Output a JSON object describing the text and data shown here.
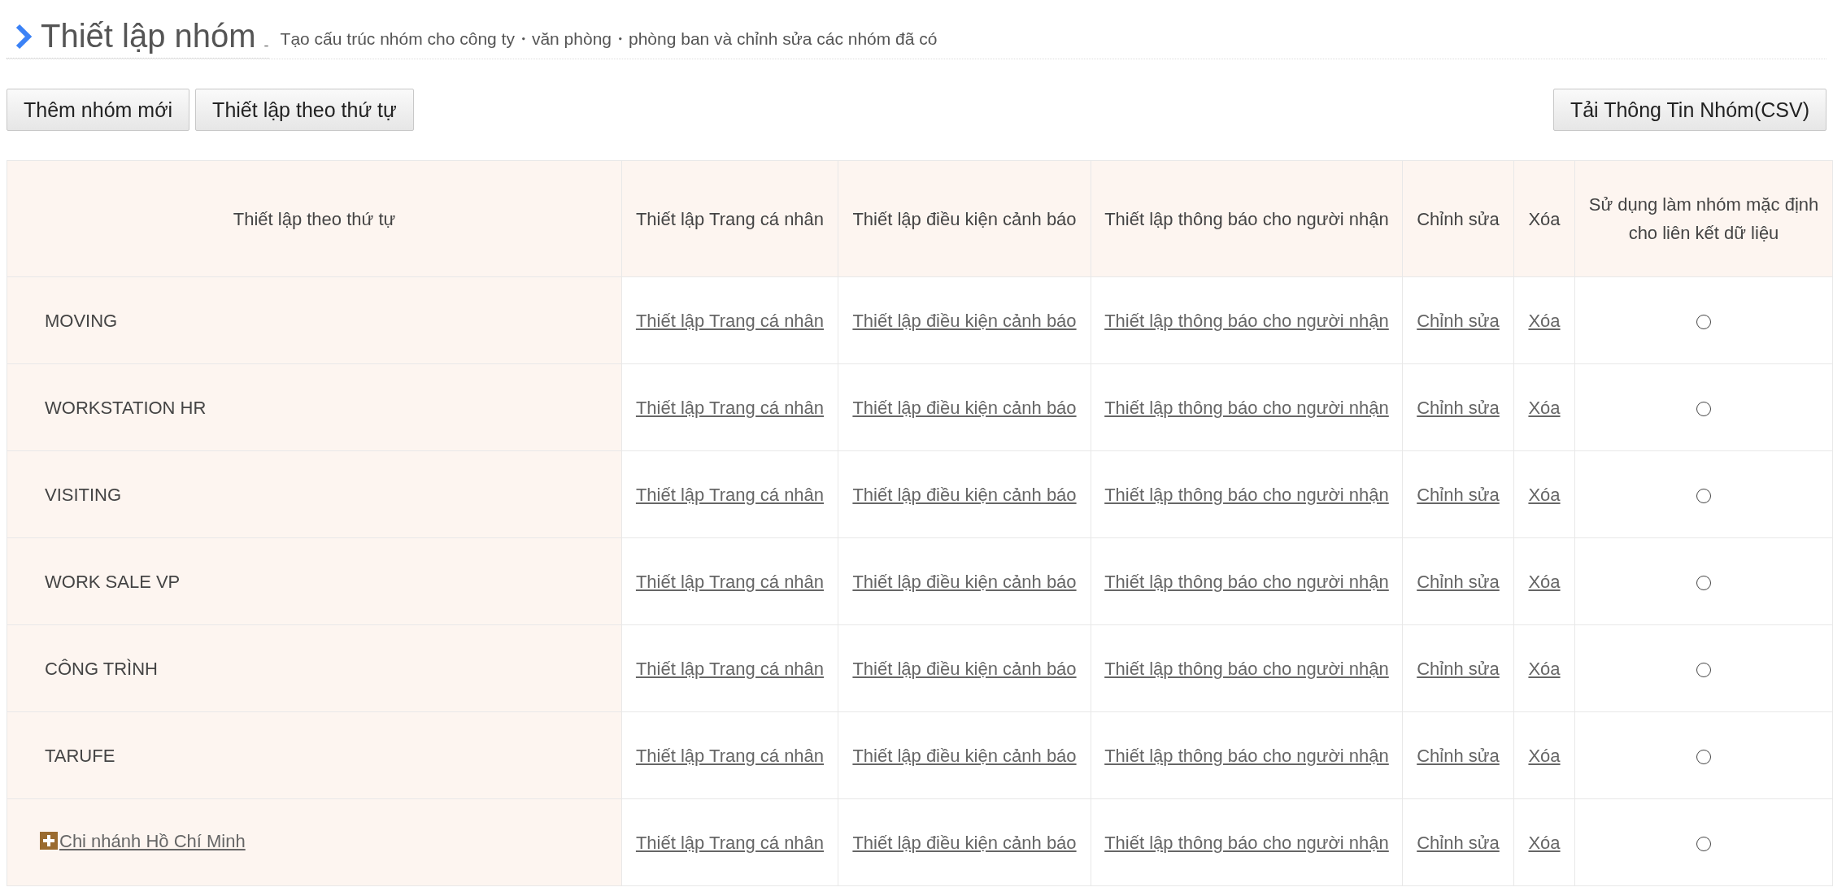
{
  "header": {
    "title": "Thiết lập nhóm",
    "separator": "-",
    "subtitle": "Tạo cấu trúc nhóm cho công ty・văn phòng・phòng ban và chỉnh sửa các nhóm đã có"
  },
  "toolbar": {
    "left_buttons": [
      "Thêm nhóm mới",
      "Thiết lập theo thứ tự"
    ],
    "right_button": "Tải Thông Tin Nhóm(CSV)"
  },
  "table": {
    "columns": [
      {
        "lines": [
          "Thiết lập theo thứ tự"
        ]
      },
      {
        "lines": [
          "Thiết lập Trang cá nhân"
        ]
      },
      {
        "lines": [
          "Thiết lập điều kiện cảnh báo"
        ]
      },
      {
        "lines": [
          "Thiết lập thông báo cho người nhận"
        ]
      },
      {
        "lines": [
          "Chỉnh sửa"
        ]
      },
      {
        "lines": [
          "Xóa"
        ]
      },
      {
        "lines": [
          "Sử dụng làm nhóm mặc định",
          "cho liên kết dữ liệu"
        ]
      }
    ],
    "rows": [
      {
        "kind": "plain",
        "name": "MOVING",
        "links": [
          "Thiết lập Trang cá nhân",
          "Thiết lập điều kiện cảnh báo",
          "Thiết lập thông báo cho người nhận",
          "Chỉnh sửa",
          "Xóa"
        ],
        "selected": false
      },
      {
        "kind": "plain",
        "name": "WORKSTATION HR",
        "links": [
          "Thiết lập Trang cá nhân",
          "Thiết lập điều kiện cảnh báo",
          "Thiết lập thông báo cho người nhận",
          "Chỉnh sửa",
          "Xóa"
        ],
        "selected": false
      },
      {
        "kind": "plain",
        "name": "VISITING",
        "links": [
          "Thiết lập Trang cá nhân",
          "Thiết lập điều kiện cảnh báo",
          "Thiết lập thông báo cho người nhận",
          "Chỉnh sửa",
          "Xóa"
        ],
        "selected": false
      },
      {
        "kind": "plain",
        "name": "WORK SALE VP",
        "links": [
          "Thiết lập Trang cá nhân",
          "Thiết lập điều kiện cảnh báo",
          "Thiết lập thông báo cho người nhận",
          "Chỉnh sửa",
          "Xóa"
        ],
        "selected": false
      },
      {
        "kind": "plain",
        "name": "CÔNG TRÌNH",
        "links": [
          "Thiết lập Trang cá nhân",
          "Thiết lập điều kiện cảnh báo",
          "Thiết lập thông báo cho người nhận",
          "Chỉnh sửa",
          "Xóa"
        ],
        "selected": false
      },
      {
        "kind": "plain",
        "name": "TARUFE",
        "links": [
          "Thiết lập Trang cá nhân",
          "Thiết lập điều kiện cảnh báo",
          "Thiết lập thông báo cho người nhận",
          "Chỉnh sửa",
          "Xóa"
        ],
        "selected": false
      },
      {
        "kind": "expandable",
        "name": "Chi nhánh Hồ Chí Minh",
        "links": [
          "Thiết lập Trang cá nhân",
          "Thiết lập điều kiện cảnh báo",
          "Thiết lập thông báo cho người nhận",
          "Chỉnh sửa",
          "Xóa"
        ],
        "selected": false
      }
    ]
  }
}
